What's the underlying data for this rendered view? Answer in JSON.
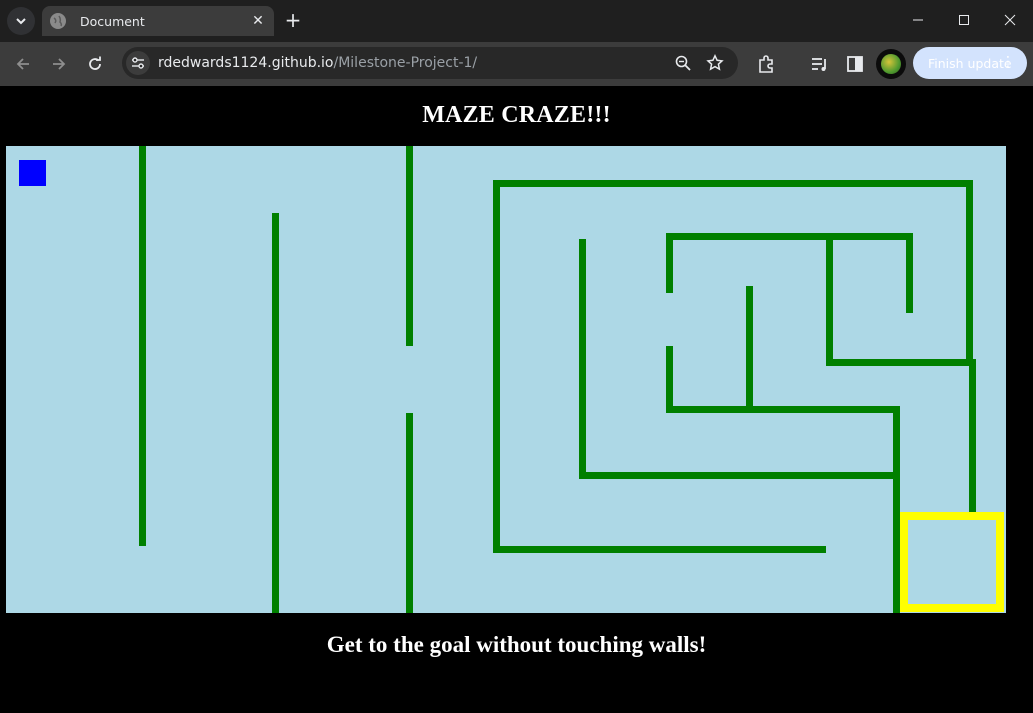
{
  "browser": {
    "tab_title": "Document",
    "url_host": "rdedwards1124.github.io",
    "url_path": "/Milestone-Project-1/",
    "update_button_label": "Finish update"
  },
  "game": {
    "title": "MAZE CRAZE!!!",
    "instructions": "Get to the goal without touching walls!"
  },
  "colors": {
    "maze_background": "#add8e6",
    "wall": "#008000",
    "player": "#0000ff",
    "goal_border": "#ffff00"
  }
}
